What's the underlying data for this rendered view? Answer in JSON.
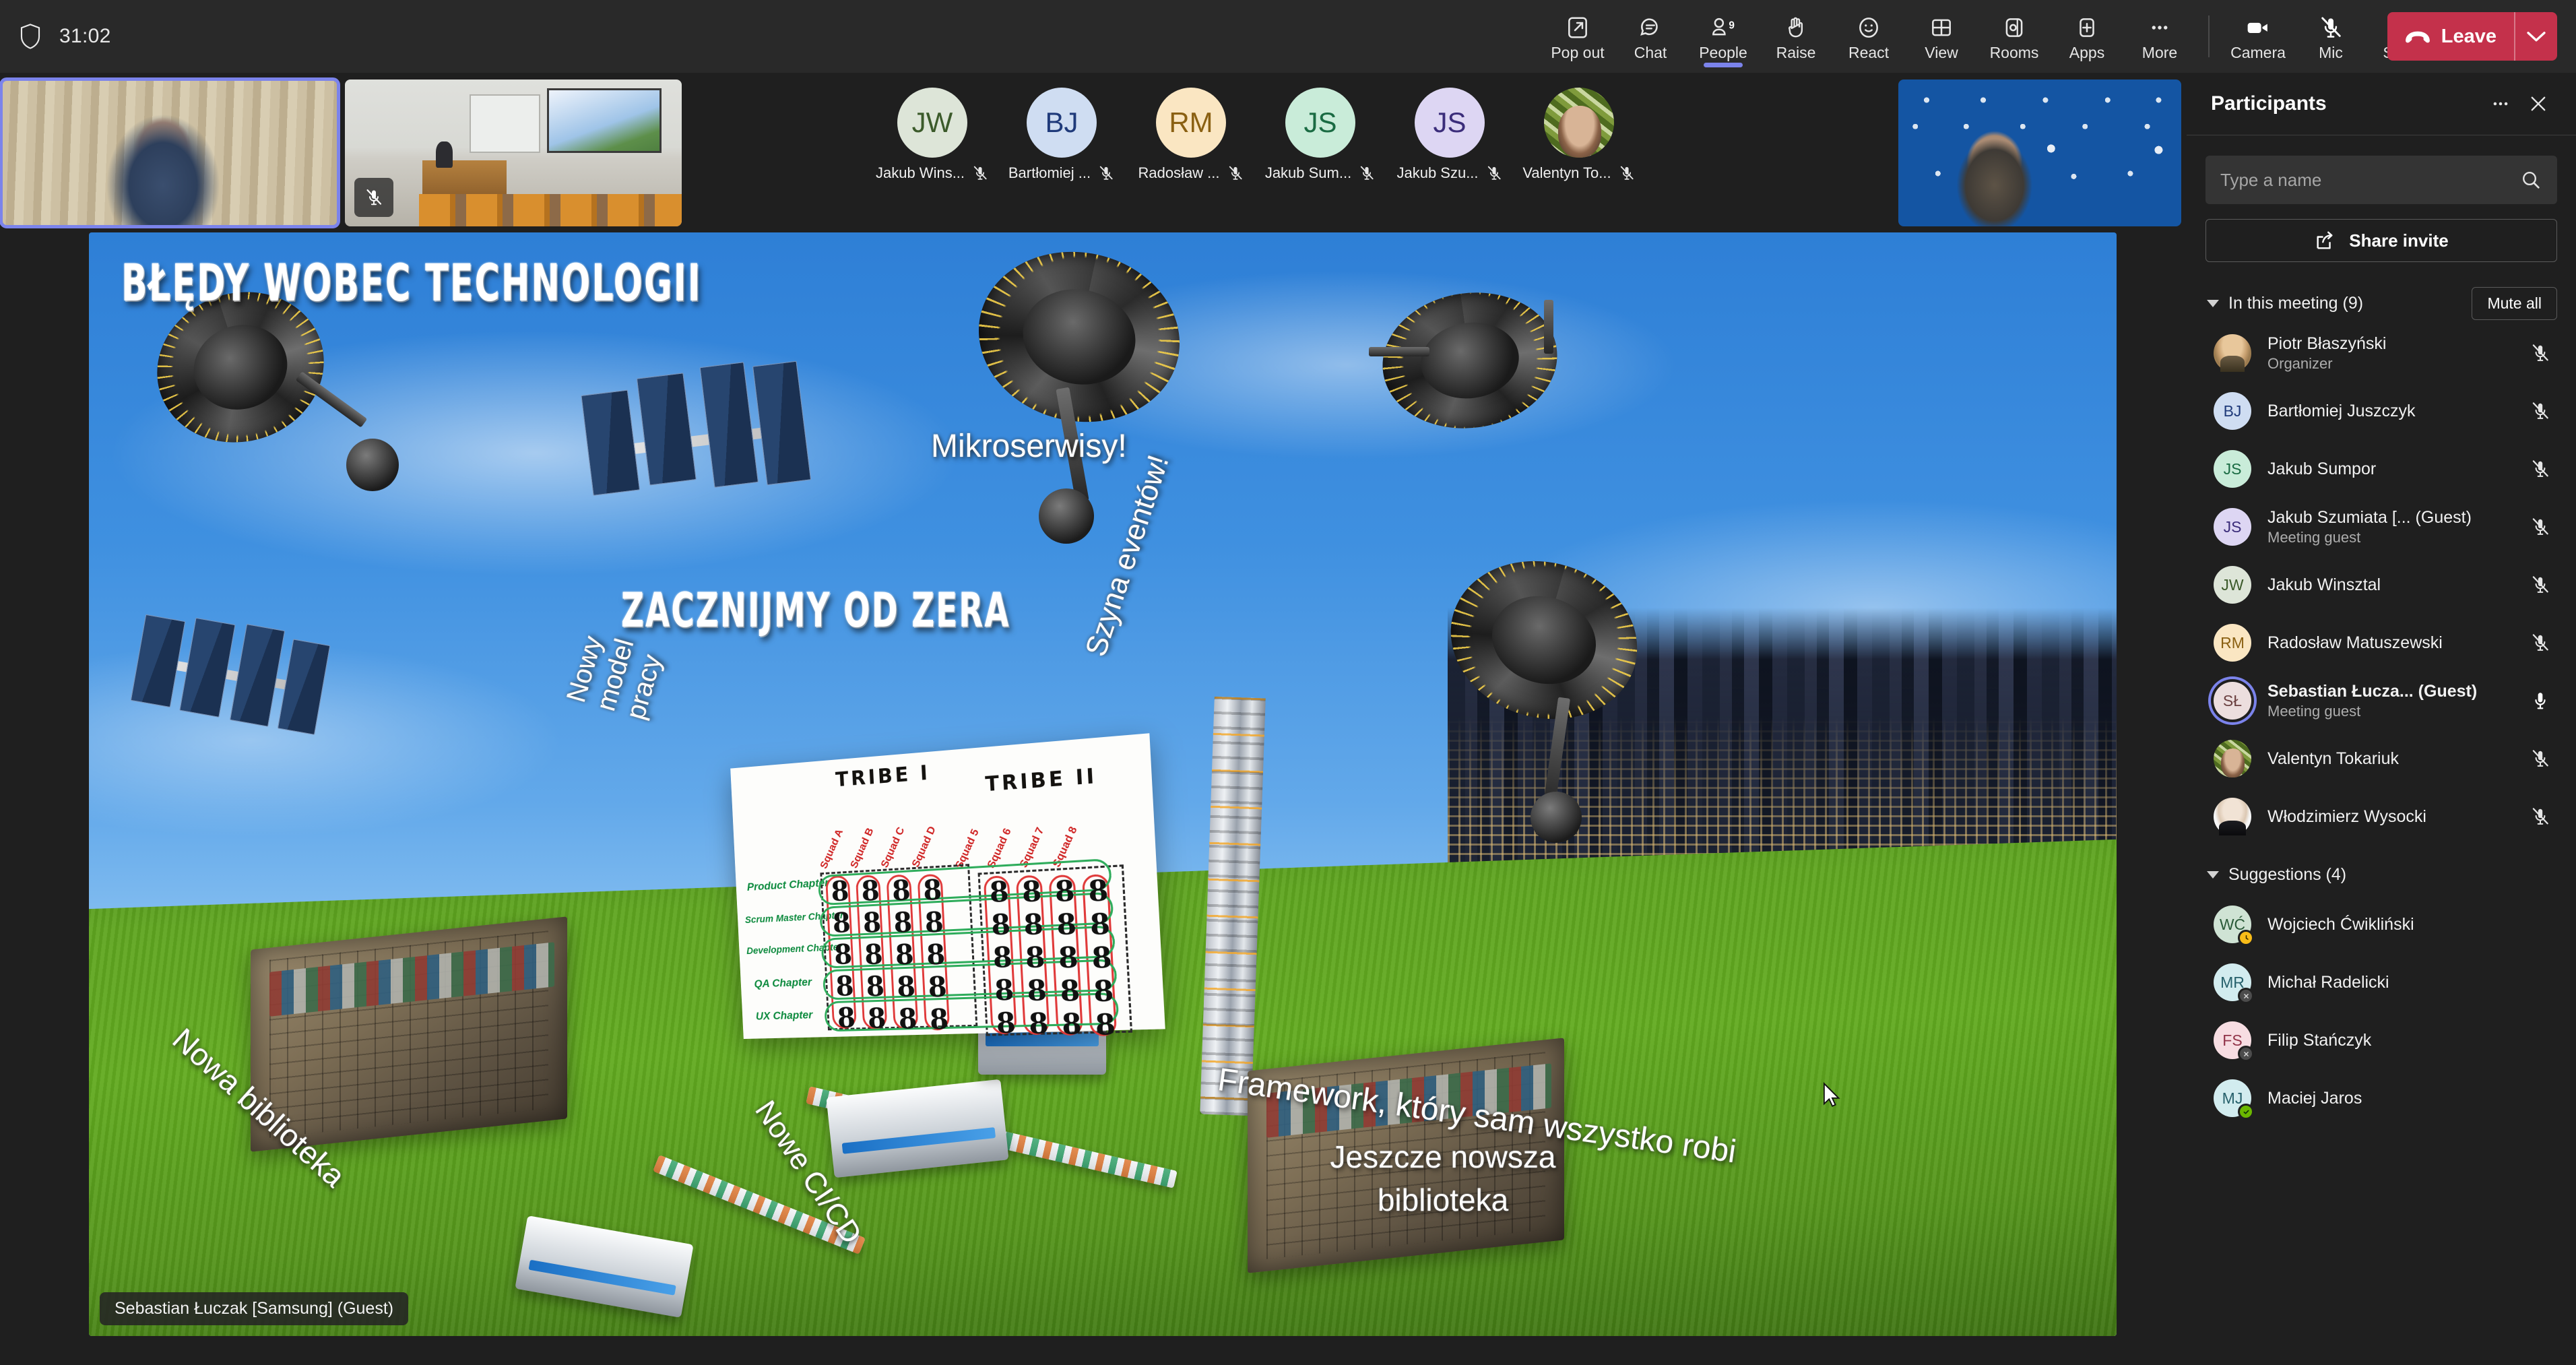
{
  "topbar": {
    "shield_icon": "shield-icon",
    "timer": "31:02",
    "items": [
      {
        "label": "Pop out",
        "icon": "pop-out-icon",
        "active": false
      },
      {
        "label": "Chat",
        "icon": "chat-icon",
        "active": false
      },
      {
        "label": "People",
        "icon": "people-icon",
        "badge": "9",
        "active": true
      },
      {
        "label": "Raise",
        "icon": "raise-hand-icon",
        "active": false
      },
      {
        "label": "React",
        "icon": "react-smiley-icon",
        "active": false
      },
      {
        "label": "View",
        "icon": "view-grid-icon",
        "active": false
      },
      {
        "label": "Rooms",
        "icon": "breakout-rooms-icon",
        "active": false
      },
      {
        "label": "Apps",
        "icon": "apps-plus-icon",
        "active": false
      },
      {
        "label": "More",
        "icon": "more-ellipsis-icon",
        "active": false
      }
    ],
    "device_items": [
      {
        "label": "Camera",
        "icon": "camera-icon",
        "state": "on"
      },
      {
        "label": "Mic",
        "icon": "mic-off-icon",
        "state": "muted"
      },
      {
        "label": "Share",
        "icon": "share-up-arrow-icon",
        "state": "on"
      }
    ],
    "leave": {
      "label": "Leave",
      "icon": "hang-up-icon",
      "chevron": "chevron-down-icon",
      "color": "#c4314b"
    }
  },
  "video_tiles": [
    {
      "name": "tile-webcam-presenter",
      "active_speaker": true,
      "muted": false
    },
    {
      "name": "tile-lecture-room",
      "active_speaker": false,
      "muted": true
    },
    {
      "name": "tile-webcam-headphones",
      "active_speaker": false,
      "muted": false
    }
  ],
  "roster": [
    {
      "initials": "JW",
      "name": "Jakub Wins...",
      "bg": "#dde5d8",
      "fg": "#3b5a2a",
      "muted": true,
      "photo": false
    },
    {
      "initials": "BJ",
      "name": "Bartłomiej ...",
      "bg": "#cfddf2",
      "fg": "#1f3a7a",
      "muted": true,
      "photo": false
    },
    {
      "initials": "RM",
      "name": "Radosław ...",
      "bg": "#fae6c2",
      "fg": "#8a6012",
      "muted": true,
      "photo": false
    },
    {
      "initials": "JS",
      "name": "Jakub Sum...",
      "bg": "#c9ecd9",
      "fg": "#1a6b43",
      "muted": true,
      "photo": false
    },
    {
      "initials": "JS",
      "name": "Jakub Szu...",
      "bg": "#ddd6f3",
      "fg": "#3b2d7a",
      "muted": true,
      "photo": false
    },
    {
      "initials": "VT",
      "name": "Valentyn To...",
      "bg": "#5c7a2a",
      "fg": "#ffffff",
      "muted": true,
      "photo": true
    }
  ],
  "slide": {
    "title": "BŁĘDY WOBEC TECHNOLOGII",
    "headline": "ZACZNIJMY OD ZERA",
    "labels": [
      "Mikroserwisy!",
      "Nowy model pracy",
      "Szyna eventów!",
      "Nowa biblioteka",
      "Nowe CI/CD",
      "Framework, który sam wszystko robi",
      "Jeszcze nowsza biblioteka"
    ],
    "whiteboard": {
      "tribes": [
        "TRIBE I",
        "TRIBE II"
      ],
      "squads": [
        "Squad A",
        "Squad B",
        "Squad C",
        "Squad D",
        "Squad 5",
        "Squad 6",
        "Squad 7",
        "Squad 8"
      ],
      "chapters": [
        "Product Chapter",
        "Scrum Master Chapter",
        "Development Chapter",
        "QA Chapter",
        "UX Chapter"
      ],
      "cell_glyph": "8"
    },
    "presenter_badge": "Sebastian Łuczak [Samsung] (Guest)"
  },
  "panel": {
    "title": "Participants",
    "more_icon": "more-ellipsis-icon",
    "close_icon": "close-x-icon",
    "search": {
      "placeholder": "Type a name",
      "value": "",
      "icon": "search-icon"
    },
    "share_invite": {
      "label": "Share invite",
      "icon": "share-invite-icon"
    },
    "in_meeting": {
      "label": "In this meeting (9)",
      "count": 9,
      "mute_all": "Mute all",
      "caret": "caret-down-icon"
    },
    "participants": [
      {
        "name": "Piotr Błaszyński",
        "role": "Organizer",
        "initials": "PB",
        "bg": "#e0b469",
        "fg": "#4a3a18",
        "photo": "ph-piotr",
        "muted": true,
        "speaking": false,
        "bold": false
      },
      {
        "name": "Bartłomiej Juszczyk",
        "role": "",
        "initials": "BJ",
        "bg": "#cfddf2",
        "fg": "#1f3a7a",
        "photo": "",
        "muted": true,
        "speaking": false,
        "bold": false
      },
      {
        "name": "Jakub Sumpor",
        "role": "",
        "initials": "JS",
        "bg": "#c9ecd9",
        "fg": "#1a6b43",
        "photo": "",
        "muted": true,
        "speaking": false,
        "bold": false
      },
      {
        "name": "Jakub Szumiata [... (Guest)",
        "role": "Meeting guest",
        "initials": "JS",
        "bg": "#ddd6f3",
        "fg": "#3b2d7a",
        "photo": "",
        "muted": true,
        "speaking": false,
        "bold": false
      },
      {
        "name": "Jakub Winsztal",
        "role": "",
        "initials": "JW",
        "bg": "#dde5d8",
        "fg": "#3b5a2a",
        "photo": "",
        "muted": true,
        "speaking": false,
        "bold": false
      },
      {
        "name": "Radosław Matuszewski",
        "role": "",
        "initials": "RM",
        "bg": "#fae6c2",
        "fg": "#8a6012",
        "photo": "",
        "muted": true,
        "speaking": false,
        "bold": false
      },
      {
        "name": "Sebastian Łucza... (Guest)",
        "role": "Meeting guest",
        "initials": "SŁ",
        "bg": "#ecdede",
        "fg": "#6b4040",
        "photo": "",
        "muted": false,
        "speaking": true,
        "bold": true
      },
      {
        "name": "Valentyn Tokariuk",
        "role": "",
        "initials": "VT",
        "bg": "#5c7a2a",
        "fg": "#ffffff",
        "photo": "ph-valsm",
        "muted": true,
        "speaking": false,
        "bold": false
      },
      {
        "name": "Włodzimierz Wysocki",
        "role": "",
        "initials": "WW",
        "bg": "#e8e8e8",
        "fg": "#3a3a3a",
        "photo": "ph-wlodek",
        "muted": true,
        "speaking": false,
        "bold": false
      }
    ],
    "suggestions": {
      "label": "Suggestions (4)",
      "count": 4,
      "caret": "caret-down-icon"
    },
    "suggested": [
      {
        "name": "Wojciech Ćwikliński",
        "initials": "WĆ",
        "bg": "#cfe3d4",
        "fg": "#2a5a38",
        "presence": "away",
        "presence_icon": "clock-icon"
      },
      {
        "name": "Michał Radelicki",
        "initials": "MR",
        "bg": "#d2ecef",
        "fg": "#26606b",
        "presence": "offline",
        "presence_icon": "x-circle-icon"
      },
      {
        "name": "Filip Stańczyk",
        "initials": "FS",
        "bg": "#f7dde2",
        "fg": "#913348",
        "presence": "offline",
        "presence_icon": "x-circle-icon"
      },
      {
        "name": "Maciej Jaros",
        "initials": "MJ",
        "bg": "#d2ecef",
        "fg": "#26606b",
        "presence": "available",
        "presence_icon": "check-circle-icon"
      }
    ]
  },
  "colors": {
    "accent": "#7b83eb",
    "leave": "#c4314b",
    "bg": "#1f1f1f",
    "topbar": "#292929",
    "available": "#6bb700",
    "away": "#f8bc18",
    "offline": "#4c4c4c"
  }
}
